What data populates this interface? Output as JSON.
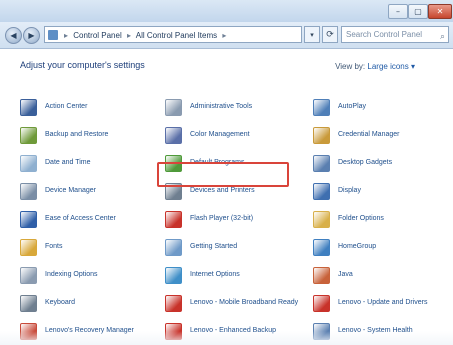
{
  "window": {
    "caption_buttons": {
      "minimize": "–",
      "maximize": "▢",
      "close": "✕"
    }
  },
  "navbar": {
    "back_glyph": "◀",
    "forward_glyph": "▶",
    "breadcrumb": [
      "Control Panel",
      "All Control Panel Items"
    ],
    "breadcrumb_separator": "▸",
    "dropdown_glyph": "▾",
    "refresh_glyph": "⟳",
    "search_placeholder": "Search Control Panel"
  },
  "header": {
    "title": "Adjust your computer's settings",
    "view_by_label": "View by:",
    "view_by_value": "Large icons ▾"
  },
  "items": [
    {
      "label": "Action Center",
      "icon": "flag-icon",
      "color": "#3a5f9a"
    },
    {
      "label": "Administrative Tools",
      "icon": "admin-tools-icon",
      "color": "#8a9bb0"
    },
    {
      "label": "AutoPlay",
      "icon": "autoplay-icon",
      "color": "#4f7fb8"
    },
    {
      "label": "Backup and Restore",
      "icon": "backup-icon",
      "color": "#6f9a3a"
    },
    {
      "label": "Color Management",
      "icon": "color-management-icon",
      "color": "#5a6fa8"
    },
    {
      "label": "Credential Manager",
      "icon": "credential-icon",
      "color": "#c99a3a"
    },
    {
      "label": "Date and Time",
      "icon": "clock-icon",
      "color": "#8fb0d0"
    },
    {
      "label": "Default Programs",
      "icon": "default-programs-icon",
      "color": "#4f9a3a"
    },
    {
      "label": "Desktop Gadgets",
      "icon": "gadgets-icon",
      "color": "#5a7fb0"
    },
    {
      "label": "Device Manager",
      "icon": "device-manager-icon",
      "color": "#7a8ea6"
    },
    {
      "label": "Devices and Printers",
      "icon": "printer-icon",
      "color": "#6f7f90"
    },
    {
      "label": "Display",
      "icon": "display-icon",
      "color": "#3f6fb0"
    },
    {
      "label": "Ease of Access Center",
      "icon": "ease-of-access-icon",
      "color": "#2f5fa8"
    },
    {
      "label": "Flash Player (32-bit)",
      "icon": "flash-icon",
      "color": "#c8322a"
    },
    {
      "label": "Folder Options",
      "icon": "folder-icon",
      "color": "#d8b04a"
    },
    {
      "label": "Fonts",
      "icon": "fonts-icon",
      "color": "#d8a83a"
    },
    {
      "label": "Getting Started",
      "icon": "getting-started-icon",
      "color": "#6f9ac8"
    },
    {
      "label": "HomeGroup",
      "icon": "homegroup-icon",
      "color": "#3f7fc0"
    },
    {
      "label": "Indexing Options",
      "icon": "indexing-icon",
      "color": "#8a9bb0"
    },
    {
      "label": "Internet Options",
      "icon": "internet-icon",
      "color": "#3f8fc8"
    },
    {
      "label": "Java",
      "icon": "java-icon",
      "color": "#c8623a"
    },
    {
      "label": "Keyboard",
      "icon": "keyboard-icon",
      "color": "#6f7f90"
    },
    {
      "label": "Lenovo - Mobile Broadband Ready",
      "icon": "lenovo-broadband-icon",
      "color": "#c8322a"
    },
    {
      "label": "Lenovo - Update and Drivers",
      "icon": "lenovo-update-icon",
      "color": "#c8322a"
    },
    {
      "label": "Lenovo's Recovery Manager",
      "icon": "recovery-icon",
      "color": "#c84a3a"
    },
    {
      "label": "Lenovo - Enhanced Backup",
      "icon": "lenovo-backup-icon",
      "color": "#c8322a"
    },
    {
      "label": "Lenovo - System Health",
      "icon": "system-health-icon",
      "color": "#5a7fb0"
    }
  ]
}
